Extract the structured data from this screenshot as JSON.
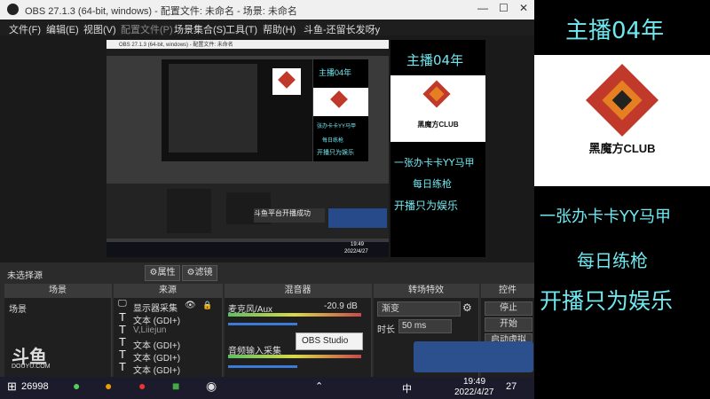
{
  "window": {
    "title": "OBS 27.1.3 (64-bit, windows) - 配置文件: 未命名 - 场景: 未命名",
    "controls": [
      "—",
      "☐",
      "✕"
    ]
  },
  "menu": {
    "items": [
      "文件(F)",
      "编辑(E)",
      "视图(V)",
      "配置文件(P)",
      "场景集合(S)",
      "工具(T)",
      "帮助(H)",
      "斗鱼-还留长发呀y"
    ]
  },
  "preview": {
    "nested_title": "OBS 27.1.3 (64-bit, windows) - 配置文件: 未命名",
    "nested_popup": "斗鱼平台开播成功",
    "nested_clock_time": "19:49",
    "nested_clock_date": "2022/4/27"
  },
  "status": {
    "no_source": "未选择源",
    "properties_btn": "属性",
    "filters_btn": "滤镜"
  },
  "docks": {
    "scenes": {
      "header": "场景",
      "items": [
        "场景"
      ],
      "logo_text": "斗鱼",
      "logo_sub": "DOUYU.COM"
    },
    "sources": {
      "header": "来源",
      "items": [
        {
          "icon": "monitor-icon",
          "label": "显示器采集"
        },
        {
          "icon": "text-icon",
          "label": "文本 (GDI+)"
        },
        {
          "icon": "text-icon",
          "label": "V,Liiejun"
        },
        {
          "icon": "text-icon",
          "label": "文本 (GDI+)"
        },
        {
          "icon": "text-icon",
          "label": "文本 (GDI+)"
        },
        {
          "icon": "text-icon",
          "label": "文本 (GDI+)"
        }
      ]
    },
    "mixer": {
      "header": "混音器",
      "mic_label": "麦克风/Aux",
      "mic_db": "-20.9 dB",
      "desktop_label": "音频输入采集"
    },
    "transitions": {
      "header": "转场特效",
      "type": "渐变",
      "duration_label": "时长",
      "duration_value": "50 ms"
    },
    "controls": {
      "header": "控件",
      "buttons": [
        "停止",
        "开始",
        "启动虚拟"
      ]
    }
  },
  "popup": {
    "obs_studio": "OBS Studio"
  },
  "taskbar": {
    "temp": "26998",
    "clock_time": "19:49",
    "clock_date": "2022/4/27",
    "ime": "中",
    "notification": "27"
  },
  "overlay": {
    "title": "主播04年",
    "logo_text": "黑魔方CLUB",
    "line1": "一张办卡卡YY马甲",
    "line2": "每日练枪",
    "line3": "开播只为娱乐"
  },
  "colors": {
    "accent_cyan": "#6fe7ef",
    "obs_bg": "#2b2b2b",
    "logo_red": "#c0392b",
    "logo_orange": "#e67e22"
  }
}
